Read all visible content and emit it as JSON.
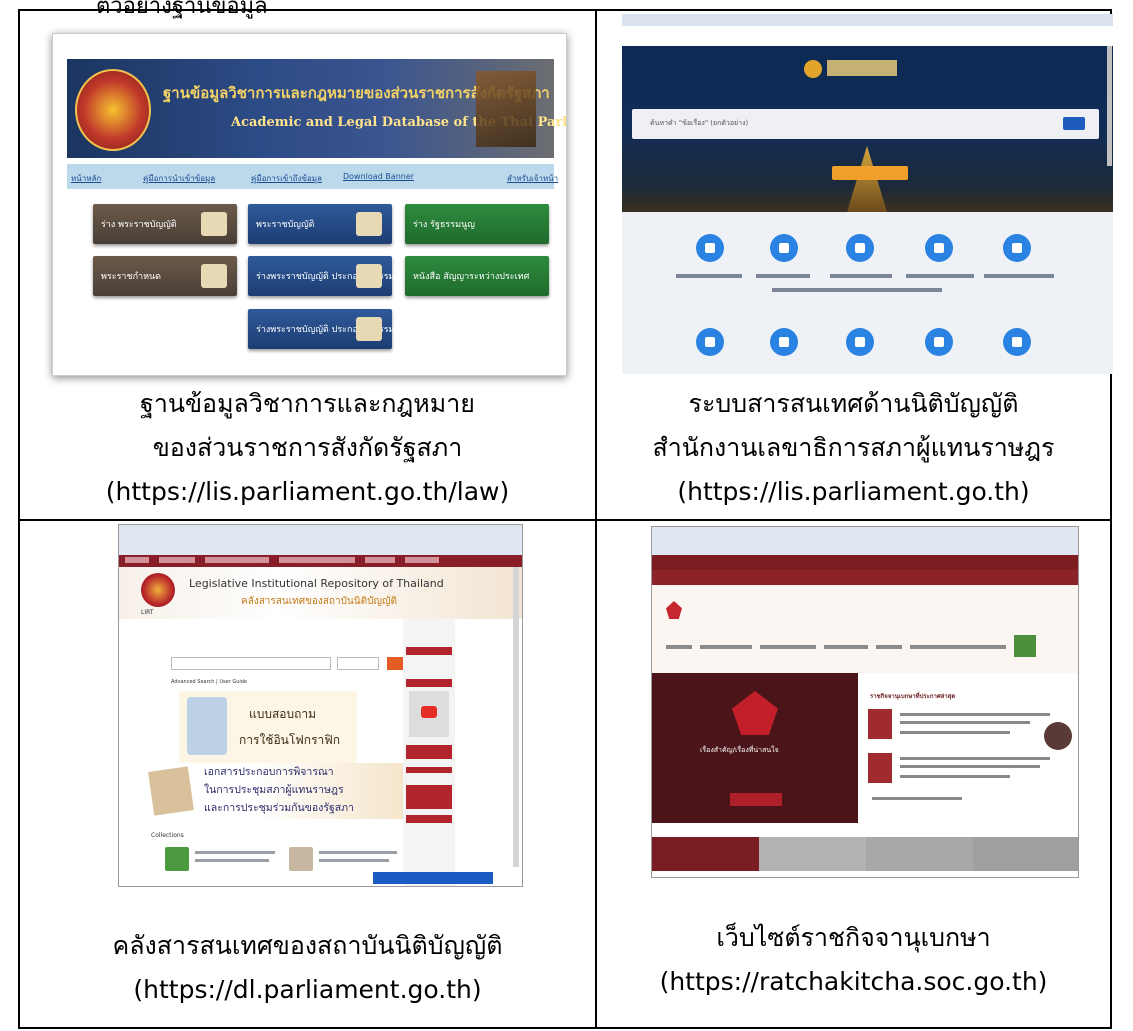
{
  "top_fragment": "ตัวอย่างฐานข้อมูล",
  "cells": [
    {
      "caption_lines": [
        "ฐานข้อมูลวิชาการและกฎหมาย",
        "ของส่วนราชการสังกัดรัฐสภา",
        "(https://lis.parliament.go.th/law)"
      ],
      "screenshot": {
        "title_th": "ฐานข้อมูลวิชาการและกฎหมายของส่วนราชการสังกัดรัฐสภา",
        "title_en": "Academic and Legal Database of the Thai Parliament",
        "nav": [
          "หน้าหลัก",
          "คู่มือการนำเข้าข้อมูล",
          "คู่มือการเข้าถึงข้อมูล",
          "Download Banner",
          "สำหรับเจ้าหน้า"
        ],
        "tiles": [
          "ร่าง พระราชบัญญัติ",
          "พระราชบัญญัติ",
          "ร่าง รัฐธรรมนูญ",
          "พระราชกำหนด",
          "ร่างพระราชบัญญัติ ประกอบรัฐธรรมนูญ",
          "หนังสือ สัญญาระหว่างประเทศ",
          "ร่างพระราชบัญญัติ ประกอบรัฐธรรมนูญ"
        ]
      }
    },
    {
      "caption_lines": [
        "ระบบสารสนเทศด้านนิติบัญญัติ",
        "สำนักงานเลขาธิการสภาผู้แทนราษฎร",
        "(https://lis.parliament.go.th)"
      ],
      "screenshot": {
        "search_placeholder": "ค้นหาคำ \"ข้อเรื่อง\" (ยกตัวอย่าง)"
      }
    },
    {
      "caption_lines": [
        "คลังสารสนเทศของสถาบันนิติบัญญัติ",
        "(https://dl.parliament.go.th)"
      ],
      "screenshot": {
        "title_en": "Legislative Institutional Repository of Thailand",
        "title_th": "คลังสารสนเทศของสถาบันนิติบัญญัติ",
        "seal_label": "LIRT",
        "advanced": "Advanced Search | User Guide",
        "survey_1": "แบบสอบถาม",
        "survey_2": "การใช้อินโฟกราฟิก",
        "banner": [
          "เอกสารประกอบการพิจารณา",
          "ในการประชุมสภาผู้แทนราษฎร",
          "และการประชุมร่วมกันของรัฐสภา"
        ],
        "collections": "Collections"
      }
    },
    {
      "caption_lines": [
        "เว็บไซต์ราชกิจจานุเบกษา",
        "(https://ratchakitcha.soc.go.th)"
      ],
      "screenshot": {
        "feature_text": "เรื่องสำคัญ/เรื่องที่น่าสนใจ",
        "list_heading": "ราชกิจจานุเบกษาที่ประกาศล่าสุด"
      }
    }
  ]
}
